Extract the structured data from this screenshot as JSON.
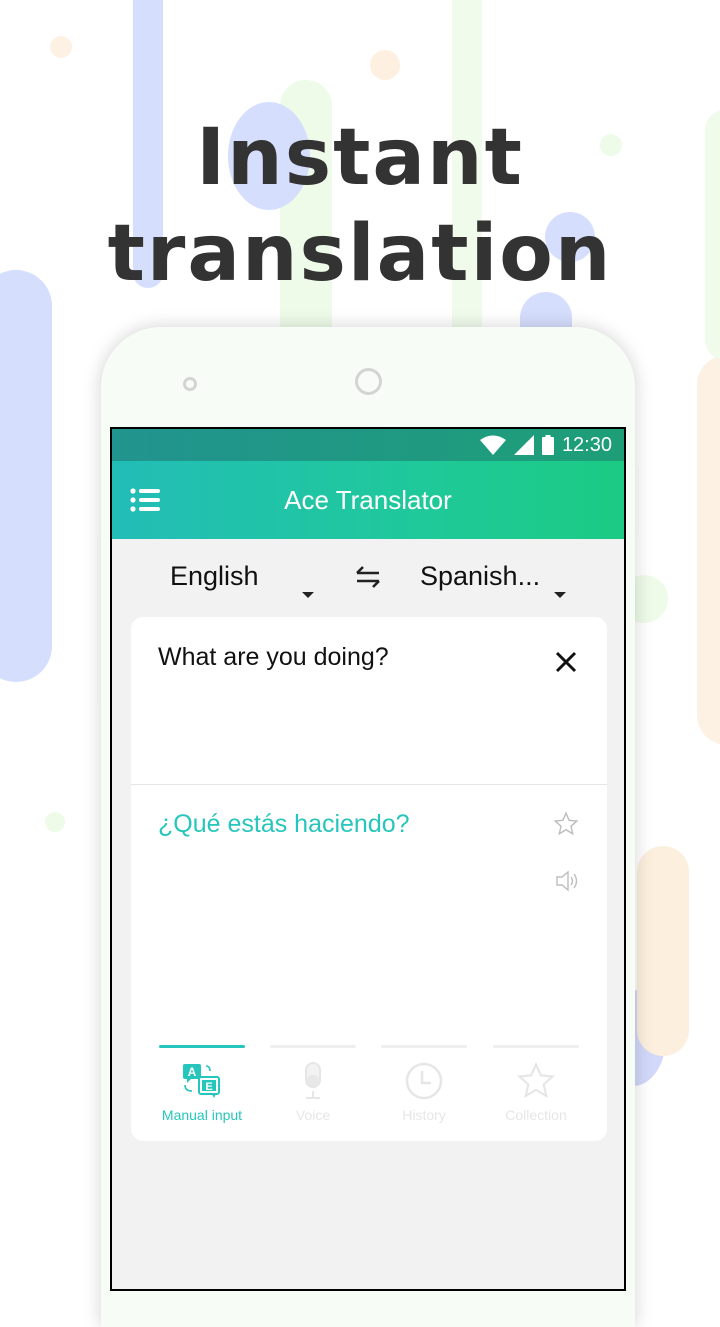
{
  "headline": {
    "line1": "Instant",
    "line2": "translation"
  },
  "colors": {
    "accent": "#26c6bc",
    "appbar_start": "#22bdb7",
    "appbar_end": "#1cca84",
    "headline": "#333333"
  },
  "statusbar": {
    "time": "12:30",
    "icons": [
      "wifi-icon",
      "signal-icon",
      "battery-icon"
    ]
  },
  "appbar": {
    "title": "Ace Translator",
    "menu_icon": "menu-icon"
  },
  "languages": {
    "source": "English",
    "target": "Spanish...",
    "swap_icon": "swap-icon"
  },
  "input": {
    "text": "What are you doing?",
    "clear_icon": "close-icon"
  },
  "output": {
    "text": "¿Qué estás haciendo?",
    "favorite_icon": "star-icon",
    "speak_icon": "speaker-icon"
  },
  "tabs": [
    {
      "label": "Manual input",
      "icon": "translate-icon",
      "active": true
    },
    {
      "label": "Voice",
      "icon": "microphone-icon",
      "active": false
    },
    {
      "label": "History",
      "icon": "clock-icon",
      "active": false
    },
    {
      "label": "Collection",
      "icon": "star-icon",
      "active": false
    }
  ]
}
